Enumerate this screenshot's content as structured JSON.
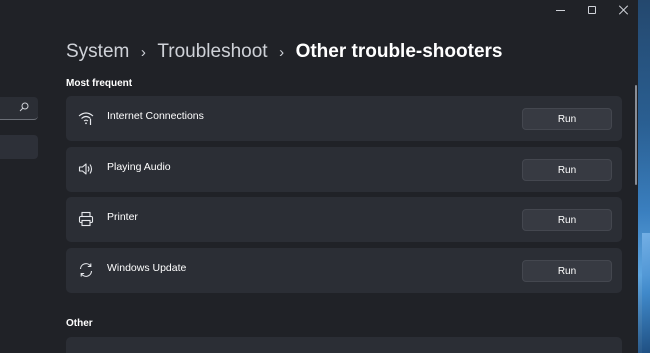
{
  "window": {
    "controls": {
      "minimize_icon": "minimize-icon",
      "maximize_icon": "maximize-icon",
      "close_icon": "close-icon"
    }
  },
  "breadcrumb": {
    "items": [
      "System",
      "Troubleshoot",
      "Other trouble-shooters"
    ],
    "separator": "›"
  },
  "sections": {
    "most_frequent": {
      "title": "Most frequent",
      "items": [
        {
          "label": "Internet Connections",
          "icon": "wifi-icon",
          "button": "Run"
        },
        {
          "label": "Playing Audio",
          "icon": "speaker-icon",
          "button": "Run"
        },
        {
          "label": "Printer",
          "icon": "printer-icon",
          "button": "Run"
        },
        {
          "label": "Windows Update",
          "icon": "sync-icon",
          "button": "Run"
        }
      ]
    },
    "other": {
      "title": "Other"
    }
  },
  "colors": {
    "window_bg": "#202227",
    "card_bg": "#2b2e35",
    "button_bg": "#373a42"
  }
}
